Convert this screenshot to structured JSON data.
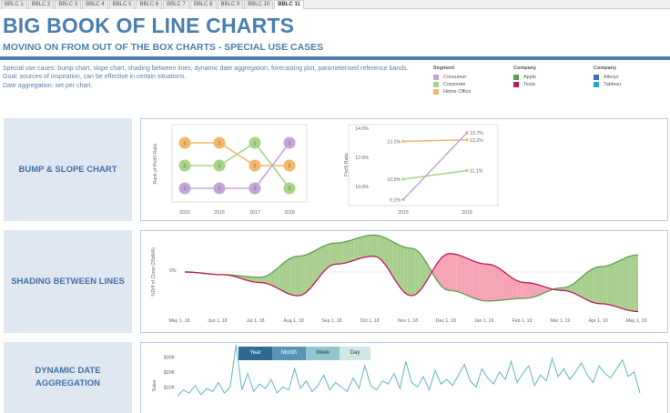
{
  "tabs": [
    "BBLC 1",
    "BBLC 2",
    "BBLC 3",
    "BBLC 4",
    "BBLC 5",
    "BBLC 6",
    "BBLC 7",
    "BBLC 8",
    "BBLC 9",
    "BBLC 10",
    "BBLC 11"
  ],
  "active_tab": 10,
  "header": {
    "title": "BIG BOOK OF LINE CHARTS",
    "subtitle": "MOVING ON FROM OUT OF THE BOX CHARTS - SPECIAL USE CASES"
  },
  "description": {
    "line1": "Special use cases: bump chart, slope chart, shading between lines, dynamic date aggregation, forecasting plot, parameterised reference bands.",
    "line2": "Goal: sources of inspiration, can be effective in certain situations.",
    "line3": "Date aggregation: set per chart."
  },
  "legends": [
    {
      "title": "Segment",
      "items": [
        {
          "label": "Consumer",
          "color": "#c5a5d8"
        },
        {
          "label": "Corporate",
          "color": "#a7d48a"
        },
        {
          "label": "Home Office",
          "color": "#f3b66b"
        }
      ]
    },
    {
      "title": "Company",
      "items": [
        {
          "label": "Apple",
          "color": "#59a14f"
        },
        {
          "label": "Tesla",
          "color": "#c2185b"
        }
      ]
    },
    {
      "title": "Company",
      "items": [
        {
          "label": "Alteryx",
          "color": "#3f6fb0"
        },
        {
          "label": "Tableau",
          "color": "#2aa6c8"
        }
      ]
    }
  ],
  "sections": {
    "bump": "BUMP & SLOPE CHART",
    "shading": "SHADING BETWEEN LINES",
    "dynamic_l1": "DYNAMIC DATE",
    "dynamic_l2": "AGGREGATION"
  },
  "date_toggle": {
    "options": [
      "Year",
      "Month",
      "Week",
      "Day"
    ],
    "selected": "Year"
  },
  "chart_data": [
    {
      "type": "line",
      "subtype": "bump",
      "ylabel": "Rank of Profit Ratio",
      "x": [
        "2015",
        "2016",
        "2017",
        "2018"
      ],
      "series": [
        {
          "name": "Home Office",
          "color": "#f3b66b",
          "ranks": [
            1,
            1,
            2,
            2
          ]
        },
        {
          "name": "Corporate",
          "color": "#a7d48a",
          "ranks": [
            2,
            2,
            1,
            3
          ]
        },
        {
          "name": "Consumer",
          "color": "#c5a5d8",
          "ranks": [
            3,
            3,
            3,
            1
          ]
        }
      ]
    },
    {
      "type": "line",
      "subtype": "slope",
      "ylabel": "Profit Ratio",
      "x": [
        "2015",
        "2018"
      ],
      "yticks": [
        "14.0%",
        "12.0%",
        "10.0%"
      ],
      "ylim": [
        9.0,
        14.0
      ],
      "series": [
        {
          "name": "Home Office",
          "color": "#f3b66b",
          "values": [
            13.1,
            13.2
          ],
          "labels": [
            "13.1%",
            "13.2%"
          ]
        },
        {
          "name": "Corporate",
          "color": "#a7d48a",
          "values": [
            10.5,
            11.1
          ],
          "labels": [
            "10.5%",
            "11.1%"
          ]
        },
        {
          "name": "Consumer",
          "color": "#c5a5d8",
          "values": [
            9.1,
            13.7
          ],
          "labels": [
            "9.1%",
            "13.7%"
          ]
        }
      ]
    },
    {
      "type": "area",
      "subtype": "shading-between-lines",
      "ylabel": "%Diff of Close (20dMA)",
      "zero_label": "0%",
      "x": [
        "May 1, 18",
        "Jun 1, 18",
        "Jul 1, 18",
        "Aug 1, 18",
        "Sep 1, 18",
        "Oct 1, 18",
        "Nov 1, 18",
        "Dec 1, 18",
        "Jan 1, 19",
        "Feb 1, 19",
        "Mar 1, 19",
        "Apr 1, 19",
        "May 1, 19"
      ],
      "series": [
        {
          "name": "Apple",
          "color": "#59a14f",
          "values": [
            0,
            -2,
            -4,
            12,
            22,
            28,
            18,
            -14,
            -22,
            -20,
            -12,
            4,
            13
          ]
        },
        {
          "name": "Tesla",
          "color": "#c2185b",
          "values": [
            0,
            -2,
            -8,
            -18,
            6,
            12,
            -18,
            14,
            6,
            -8,
            -14,
            -24,
            -30
          ]
        }
      ]
    },
    {
      "type": "line",
      "subtype": "dynamic-date-aggregation",
      "ylabel": "Sales",
      "yticks": [
        "$30K",
        "$20K",
        "$10K"
      ],
      "ylim": [
        0,
        35
      ],
      "series": [
        {
          "name": "Sales",
          "color": "#6bbcc8",
          "values": [
            4,
            8,
            6,
            11,
            5,
            9,
            7,
            13,
            6,
            10,
            38,
            8,
            19,
            7,
            12,
            9,
            15,
            6,
            10,
            8,
            22,
            9,
            14,
            7,
            11,
            18,
            8,
            13,
            10,
            7,
            16,
            9,
            24,
            11,
            8,
            14,
            12,
            19,
            9,
            27,
            13,
            10,
            17,
            8,
            21,
            12,
            15,
            11,
            18,
            25,
            14,
            10,
            22,
            16,
            12,
            20,
            15,
            27,
            13,
            19,
            24,
            11,
            18,
            14,
            29,
            17,
            22,
            15,
            20,
            26,
            18,
            13,
            24,
            19,
            16,
            22,
            28,
            17,
            20,
            6
          ]
        }
      ]
    }
  ]
}
